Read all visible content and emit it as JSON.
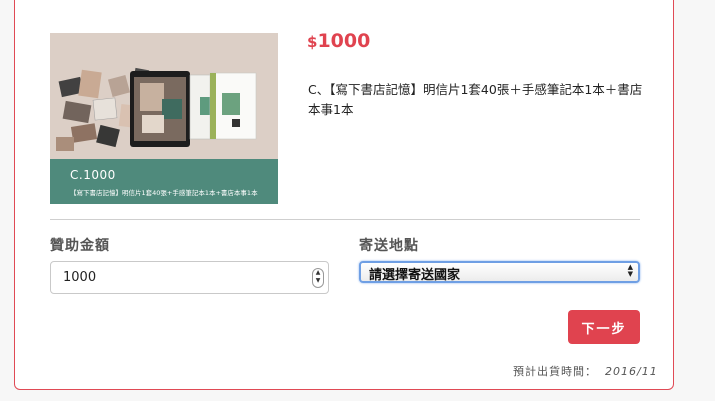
{
  "reward": {
    "currency_symbol": "$",
    "price": "1000",
    "description": "C、【寫下書店記憶】明信片1套40張＋手感筆記本1本＋書店本事1本",
    "image": {
      "code": "C.1000",
      "caption": "【寫下書店記憶】明信片1套40張+手感筆記本1本+書店本事1本"
    }
  },
  "form": {
    "amount_label": "贊助金額",
    "amount_value": "1000",
    "shipping_label": "寄送地點",
    "shipping_selected": "請選擇寄送國家",
    "next_button": "下一步"
  },
  "shipping_time": {
    "label": "預計出貨時間：",
    "date": "2016/11"
  },
  "colors": {
    "accent": "#e0434f",
    "image_band": "#4f8a7c"
  }
}
